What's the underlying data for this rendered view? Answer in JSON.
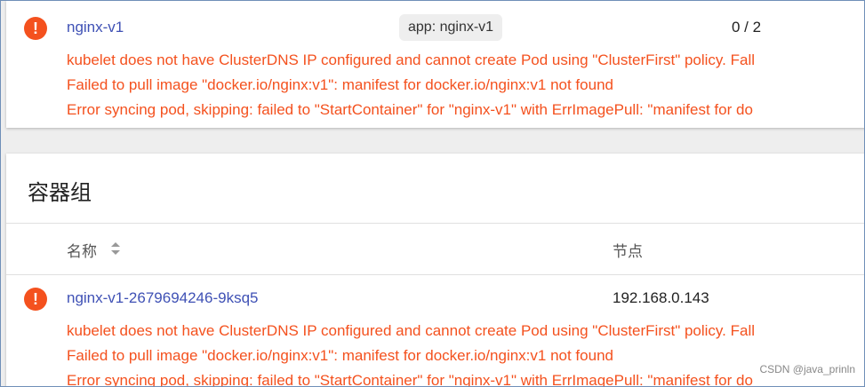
{
  "workload": {
    "name": "nginx-v1",
    "label_chip": "app: nginx-v1",
    "pods": "0 / 2",
    "errors": [
      "kubelet does not have ClusterDNS IP configured and cannot create Pod using \"ClusterFirst\" policy. Fall",
      "Failed to pull image \"docker.io/nginx:v1\": manifest for docker.io/nginx:v1 not found",
      "Error syncing pod, skipping: failed to \"StartContainer\" for \"nginx-v1\" with ErrImagePull: \"manifest for do"
    ]
  },
  "pods_section": {
    "title": "容器组",
    "columns": {
      "name": "名称",
      "node": "节点"
    },
    "rows": [
      {
        "name": "nginx-v1-2679694246-9ksq5",
        "node": "192.168.0.143",
        "errors": [
          "kubelet does not have ClusterDNS IP configured and cannot create Pod using \"ClusterFirst\" policy. Fall",
          "Failed to pull image \"docker.io/nginx:v1\": manifest for docker.io/nginx:v1 not found",
          "Error syncing pod, skipping: failed to \"StartContainer\" for \"nginx-v1\" with ErrImagePull: \"manifest for do"
        ]
      }
    ]
  },
  "icons": {
    "error": "!"
  },
  "colors": {
    "error": "#f4511e",
    "link": "#3f51b5"
  },
  "watermark": "CSDN @java_prinln"
}
